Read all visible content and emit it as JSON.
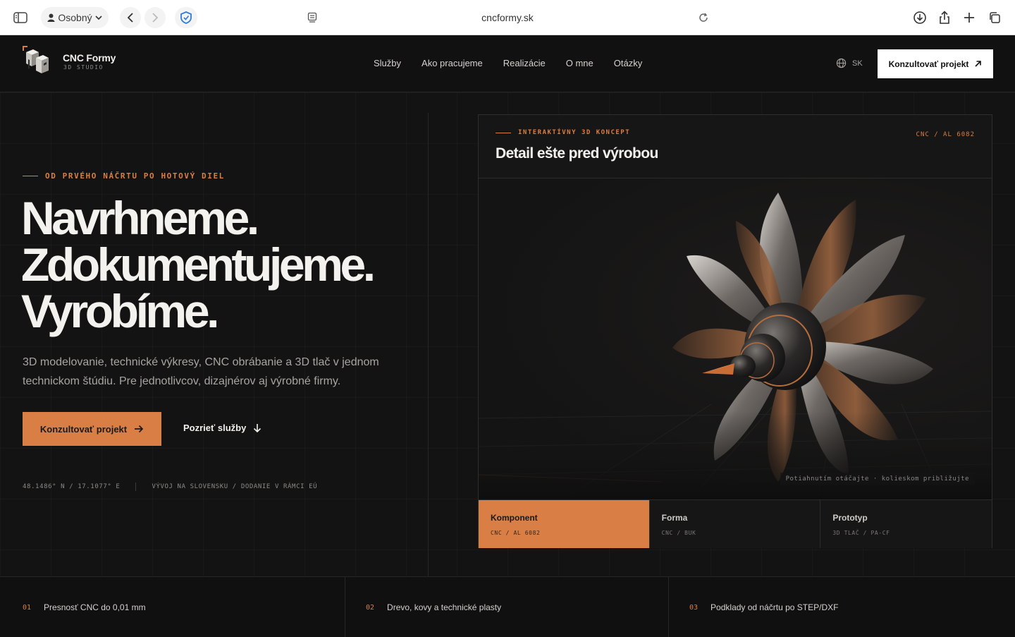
{
  "browser": {
    "profile_label": "Osobný",
    "url": "cncformy.sk"
  },
  "header": {
    "brand_name": "CNC Formy",
    "brand_sub": "3D STUDIO",
    "nav": [
      "Služby",
      "Ako pracujeme",
      "Realizácie",
      "O mne",
      "Otázky"
    ],
    "lang": "SK",
    "cta": "Konzultovať projekt"
  },
  "hero": {
    "eyebrow": "OD PRVÉHO NÁČRTU PO HOTOVÝ DIEL",
    "headline": [
      "Navrhneme.",
      "Zdokumentujeme.",
      "Vyrobíme."
    ],
    "lead": "3D modelovanie, technické výkresy, CNC obrábanie a 3D tlač v jednom technickom štúdiu. Pre jednotlivcov, dizajnérov aj výrobné firmy.",
    "primary_cta": "Konzultovať projekt",
    "secondary_cta": "Pozrieť služby",
    "coords": "48.1486° N / 17.1077° E",
    "meta": "VÝVOJ NA SLOVENSKU / DODANIE V RÁMCI EÚ"
  },
  "card": {
    "eyebrow": "INTERAKTÍVNY 3D KONCEPT",
    "code": "CNC / AL 6082",
    "title": "Detail ešte pred výrobou",
    "hint": "Potiahnutím otáčajte · kolieskom približujte",
    "tabs": [
      {
        "label": "Komponent",
        "sub": "CNC / AL 6082"
      },
      {
        "label": "Forma",
        "sub": "CNC / BUK"
      },
      {
        "label": "Prototyp",
        "sub": "3D TLAČ / PA-CF"
      }
    ]
  },
  "features": [
    {
      "num": "01",
      "text": "Presnosť CNC do 0,01 mm"
    },
    {
      "num": "02",
      "text": "Drevo, kovy a technické plasty"
    },
    {
      "num": "03",
      "text": "Podklady od náčrtu po STEP/DXF"
    }
  ],
  "colors": {
    "accent": "#d97e45",
    "background": "#131313",
    "text": "#f4f2ee"
  }
}
